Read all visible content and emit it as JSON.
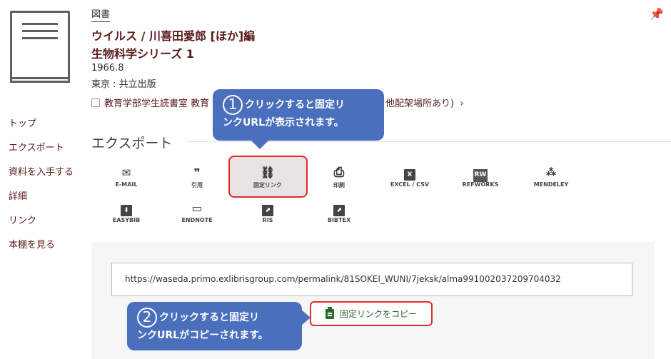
{
  "record": {
    "type_label": "図書",
    "title_line1": "ウイルス / 川喜田愛郎 [ほか]編",
    "title_line2": "生物科学シリーズ 1",
    "date": "1966.8",
    "publisher": "東京 : 共立出版",
    "availability": "教育学部学生読書室 教育",
    "availability_tail": "他配架場所あり)"
  },
  "sidebar": {
    "items": [
      "トップ",
      "エクスポート",
      "資料を入手する",
      "詳細",
      "リンク",
      "本棚を見る"
    ]
  },
  "export": {
    "title": "エクスポート",
    "row1": [
      {
        "label": "E-MAIL",
        "icon": "mail-icon",
        "glyph": "✉"
      },
      {
        "label": "引用",
        "icon": "quote-icon",
        "glyph": "❞"
      },
      {
        "label": "固定リンク",
        "icon": "link-icon",
        "glyph": "🔗"
      },
      {
        "label": "印刷",
        "icon": "print-icon",
        "glyph": "⎙"
      },
      {
        "label": "EXCEL / CSV",
        "icon": "excel-icon",
        "glyph": "X"
      },
      {
        "label": "REFWORKS",
        "icon": "refworks-icon",
        "glyph": "RW"
      },
      {
        "label": "MENDELEY",
        "icon": "mendeley-icon",
        "glyph": "ꙭ"
      }
    ],
    "row2": [
      {
        "label": "EASYBIB",
        "icon": "easybib-icon",
        "glyph": "⬇"
      },
      {
        "label": "ENDNOTE",
        "icon": "endnote-icon",
        "glyph": "⌸"
      },
      {
        "label": "RIS",
        "icon": "ris-icon",
        "glyph": "⬈"
      },
      {
        "label": "BIBTEX",
        "icon": "bibtex-icon",
        "glyph": "⬈"
      }
    ]
  },
  "permalink": {
    "url": "https://waseda.primo.exlibrisgroup.com/permalink/81SOKEI_WUNI/7jeksk/alma991002037209704032",
    "copy_label": "固定リンクをコピー"
  },
  "callouts": {
    "one_num": "1",
    "one_text_a": "クリックすると固定リ",
    "one_text_b": "ンクURLが表示されます。",
    "two_num": "2",
    "two_text_a": "クリックすると固定リ",
    "two_text_b": "ンクURLがコピーされます。"
  },
  "colors": {
    "accent": "#5a1a1a",
    "callout": "#4a6fbd",
    "highlight": "#e12b2b",
    "copy_green": "#2e6b2e"
  }
}
